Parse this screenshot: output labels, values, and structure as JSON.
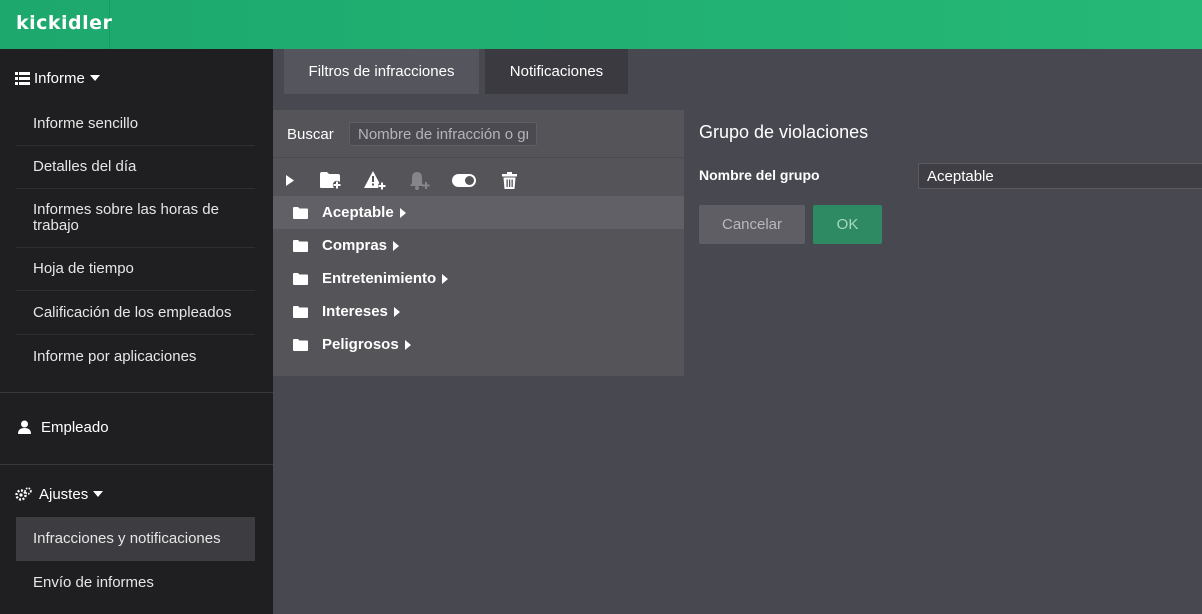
{
  "app": {
    "logo": "kickidler"
  },
  "sidebar": {
    "report_header": "Informe",
    "report_items": [
      "Informe sencillo",
      "Detalles del día",
      "Informes sobre las horas de trabajo",
      "Hoja de tiempo",
      "Calificación de los empleados",
      "Informe por aplicaciones"
    ],
    "employee": "Empleado",
    "settings_header": "Ajustes",
    "settings_items": [
      "Infracciones y notificaciones",
      "Envío de informes"
    ]
  },
  "tabs": [
    "Filtros de infracciones",
    "Notificaciones"
  ],
  "filters": {
    "search_label": "Buscar",
    "search_placeholder": "Nombre de infracción o grupo",
    "groups": [
      "Aceptable",
      "Compras",
      "Entretenimiento",
      "Intereses",
      "Peligrosos"
    ]
  },
  "editor": {
    "title": "Grupo de violaciones",
    "name_label": "Nombre del grupo",
    "name_value": "Aceptable",
    "cancel_label": "Cancelar",
    "ok_label": "OK"
  },
  "colors": {
    "accent": "#22b070",
    "sidebar_bg": "#1f1f22",
    "content_bg": "#484850"
  }
}
